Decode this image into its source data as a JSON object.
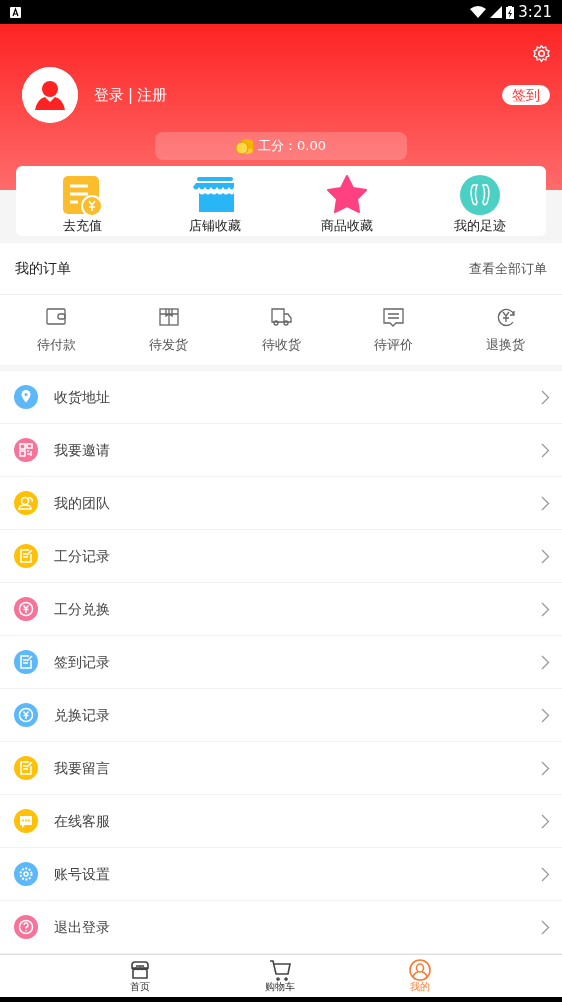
{
  "status_bar": {
    "time": "3:21"
  },
  "profile": {
    "login": "登录",
    "separator": "|",
    "register": "注册",
    "checkin": "签到",
    "points": "工分：0.00"
  },
  "shortcuts": [
    {
      "kind": "recharge",
      "label": "去充值"
    },
    {
      "kind": "store",
      "label": "店铺收藏"
    },
    {
      "kind": "star",
      "label": "商品收藏"
    },
    {
      "kind": "footprint",
      "label": "我的足迹"
    }
  ],
  "orders": {
    "title": "我的订单",
    "view_all": "查看全部订单",
    "statuses": [
      {
        "kind": "wallet",
        "label": "待付款"
      },
      {
        "kind": "box",
        "label": "待发货"
      },
      {
        "kind": "truck",
        "label": "待收货"
      },
      {
        "kind": "comment",
        "label": "待评价"
      },
      {
        "kind": "refund",
        "label": "退换货"
      }
    ]
  },
  "menu": [
    {
      "kind": "pin",
      "color": "#5cb8f8",
      "label": "收货地址"
    },
    {
      "kind": "qr",
      "color": "#f7739a",
      "label": "我要邀请"
    },
    {
      "kind": "team",
      "color": "#ffc107",
      "label": "我的团队"
    },
    {
      "kind": "note",
      "color": "#ffc107",
      "label": "工分记录"
    },
    {
      "kind": "yen",
      "color": "#f7739a",
      "label": "工分兑换"
    },
    {
      "kind": "note",
      "color": "#5cb8f8",
      "label": "签到记录"
    },
    {
      "kind": "yen",
      "color": "#5cb8f8",
      "label": "兑换记录"
    },
    {
      "kind": "note",
      "color": "#ffc107",
      "label": "我要留言"
    },
    {
      "kind": "chat",
      "color": "#ffc107",
      "label": "在线客服"
    },
    {
      "kind": "gear",
      "color": "#5cb8f8",
      "label": "账号设置"
    },
    {
      "kind": "help",
      "color": "#f7739a",
      "label": "退出登录"
    }
  ],
  "tab_bar": [
    {
      "kind": "home",
      "label": "首页",
      "selected": false
    },
    {
      "kind": "cart",
      "label": "购物车",
      "selected": false
    },
    {
      "kind": "user",
      "label": "我的",
      "selected": true
    }
  ]
}
